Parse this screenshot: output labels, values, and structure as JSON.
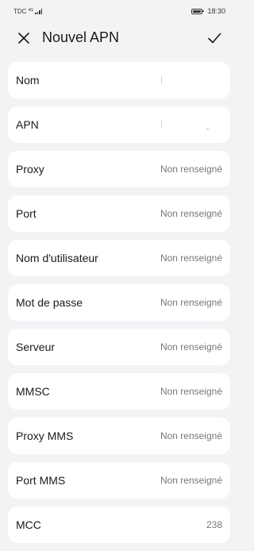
{
  "status_bar": {
    "carrier": "TDC",
    "data_indicator": "4G",
    "time": "18:30",
    "battery_level": 0.8
  },
  "titlebar": {
    "title": "Nouvel APN",
    "close_icon": "close-icon",
    "confirm_icon": "check-icon"
  },
  "fields": [
    {
      "label": "Nom",
      "value": ""
    },
    {
      "label": "APN",
      "value": ""
    },
    {
      "label": "Proxy",
      "value": "Non renseigné"
    },
    {
      "label": "Port",
      "value": "Non renseigné"
    },
    {
      "label": "Nom d'utilisateur",
      "value": "Non renseigné"
    },
    {
      "label": "Mot de passe",
      "value": "Non renseigné"
    },
    {
      "label": "Serveur",
      "value": "Non renseigné"
    },
    {
      "label": "MMSC",
      "value": "Non renseigné"
    },
    {
      "label": "Proxy MMS",
      "value": "Non renseigné"
    },
    {
      "label": "Port MMS",
      "value": "Non renseigné"
    },
    {
      "label": "MCC",
      "value": "238"
    }
  ]
}
